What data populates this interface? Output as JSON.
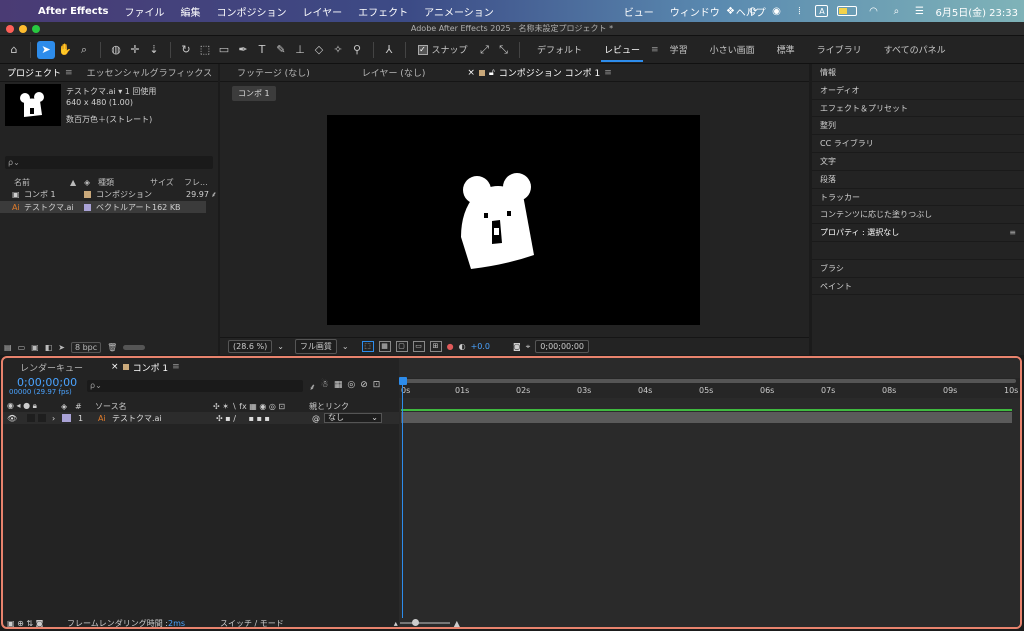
{
  "menubar": {
    "app": "After Effects",
    "items": [
      "ファイル",
      "編集",
      "コンポジション",
      "レイヤー",
      "エフェクト",
      "アニメーション",
      "ビュー",
      "ウィンドウ",
      "ヘルプ"
    ],
    "clock": "6月5日(金)  23:33",
    "input_mode": "A"
  },
  "window": {
    "title": "Adobe After Effects 2025 - 名称未設定プロジェクト *"
  },
  "toolbar": {
    "snap_label": "スナップ",
    "workspaces": [
      "デフォルト",
      "レビュー",
      "学習",
      "小さい画面",
      "標準",
      "ライブラリ",
      "すべてのパネル"
    ],
    "active_workspace": "レビュー"
  },
  "project": {
    "tabs": [
      "プロジェクト",
      "エッセンシャルグラフィックス"
    ],
    "selected_name": "テストクマ.ai ▾ 1 回使用",
    "selected_dims": "640 x 480 (1.00)",
    "selected_color": "数百万色＋(ストレート)",
    "search_placeholder": "ρ⌄",
    "columns": [
      "名前",
      "種類",
      "サイズ",
      "フレ..."
    ],
    "items": [
      {
        "name": "コンポ 1",
        "type": "コンポジション",
        "size": "",
        "fps": "29.97",
        "label_color": "#c9a87a"
      },
      {
        "name": "テストクマ.ai",
        "type": "ベクトルアート",
        "size": "162 KB",
        "fps": "",
        "label_color": "#a9a2d6"
      }
    ],
    "bpc": "8 bpc"
  },
  "viewer": {
    "tabs": [
      "フッテージ (なし)",
      "レイヤー (なし)",
      "コンポジション コンポ 1"
    ],
    "comp_tab": "コンポ 1",
    "zoom": "(28.6 %)",
    "resolution": "フル画質",
    "exposure": "+0.0",
    "timecode": "0;00;00;00"
  },
  "right_panel": {
    "items": [
      "情報",
      "オーディオ",
      "エフェクト＆プリセット",
      "整列",
      "CC ライブラリ",
      "文字",
      "段落",
      "トラッカー",
      "コンテンツに応じた塗りつぶし",
      "プロパティ : 選択なし",
      "",
      "ブラシ",
      "ペイント"
    ]
  },
  "timeline": {
    "tabs": [
      "レンダーキュー",
      "コンポ 1"
    ],
    "timecode": "0;00;00;00",
    "fps_line": "00000 (29.97 fps)",
    "columns": {
      "num": "#",
      "source": "ソース名",
      "parent": "親とリンク"
    },
    "layer": {
      "num": "1",
      "name": "テストクマ.ai",
      "parent": "なし"
    },
    "ruler": [
      "0s",
      "01s",
      "02s",
      "03s",
      "04s",
      "05s",
      "06s",
      "07s",
      "08s",
      "09s",
      "10s"
    ],
    "render_time_label": "フレームレンダリング時間 : ",
    "render_time_value": "2ms",
    "switch_mode": "スイッチ / モード"
  }
}
